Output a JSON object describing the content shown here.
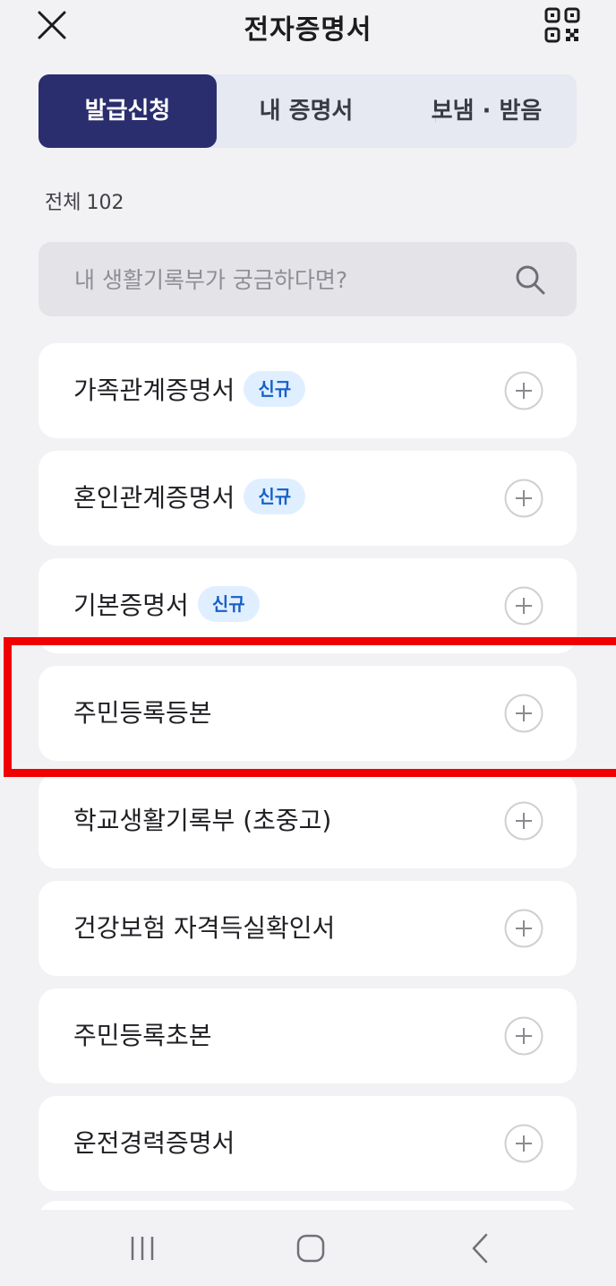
{
  "header": {
    "title": "전자증명서",
    "close_icon": "close-icon",
    "qr_icon": "qr-code-icon"
  },
  "tabs": [
    {
      "label": "발급신청",
      "active": true
    },
    {
      "label": "내 증명서",
      "active": false
    },
    {
      "label": "보냄 · 받음",
      "active": false
    }
  ],
  "count": {
    "label": "전체",
    "value": "102"
  },
  "search": {
    "placeholder": "내 생활기록부가 궁금하다면?",
    "value": "",
    "icon": "search-icon"
  },
  "documents": [
    {
      "name": "가족관계증명서",
      "badge": "신규"
    },
    {
      "name": "혼인관계증명서",
      "badge": "신규"
    },
    {
      "name": "기본증명서",
      "badge": "신규"
    },
    {
      "name": "주민등록등본",
      "badge": null,
      "highlighted": true
    },
    {
      "name": "학교생활기록부 (초중고)",
      "badge": null
    },
    {
      "name": "건강보험 자격득실확인서",
      "badge": null
    },
    {
      "name": "주민등록초본",
      "badge": null
    },
    {
      "name": "운전경력증명서",
      "badge": null
    }
  ],
  "colors": {
    "background": "#f2f2f5",
    "tab_active": "#2a2e6e",
    "tab_bg": "#e7e9f2",
    "badge_bg": "#e0efff",
    "badge_text": "#1560c8",
    "highlight_border": "#f00000"
  },
  "navbar": {
    "recent_icon": "recent-apps-icon",
    "home_icon": "home-icon",
    "back_icon": "back-icon"
  }
}
